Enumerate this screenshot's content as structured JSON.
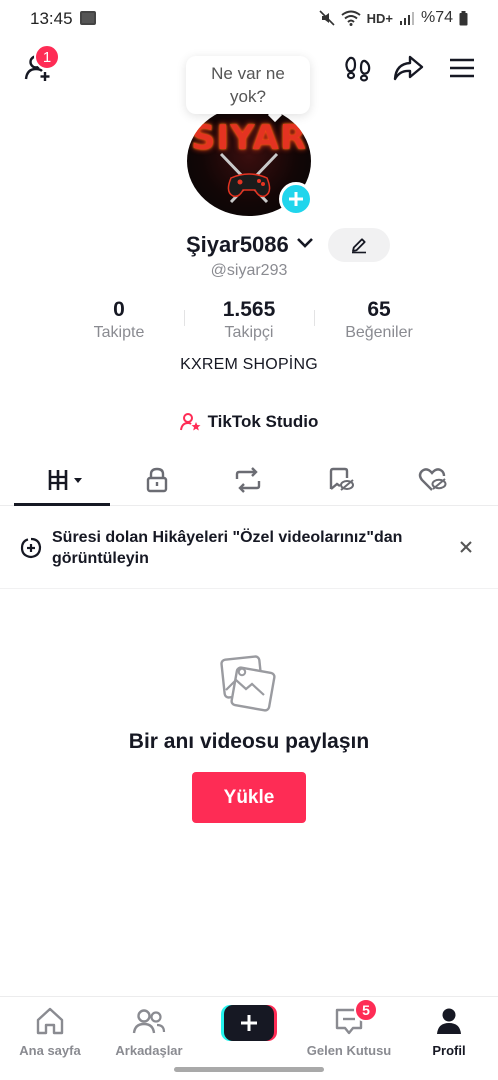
{
  "status_bar": {
    "time": "13:45",
    "battery": "%74",
    "network": "HD+"
  },
  "top_bar": {
    "friend_requests_badge": "1"
  },
  "bubble": {
    "text": "Ne var ne yok?"
  },
  "avatar": {
    "text": "SIYAR"
  },
  "profile": {
    "username": "Şiyar5086",
    "handle": "@siyar293",
    "bio": "KXREM SHOPİNG"
  },
  "stats": [
    {
      "value": "0",
      "label": "Takipte"
    },
    {
      "value": "1.565",
      "label": "Takipçi"
    },
    {
      "value": "65",
      "label": "Beğeniler"
    }
  ],
  "studio": {
    "label": "TikTok Studio"
  },
  "tabs": [
    {
      "name": "videos-grid",
      "icon": "grid-icon",
      "active": true
    },
    {
      "name": "private",
      "icon": "lock-icon",
      "active": false
    },
    {
      "name": "reposts",
      "icon": "repost-icon",
      "active": false
    },
    {
      "name": "favorites",
      "icon": "bookmark-hidden-icon",
      "active": false
    },
    {
      "name": "liked",
      "icon": "heart-hidden-icon",
      "active": false
    }
  ],
  "notice": {
    "text": "Süresi dolan Hikâyeleri \"Özel videolarınız\"dan görüntüleyin"
  },
  "empty_state": {
    "title": "Bir anı videosu paylaşın",
    "button": "Yükle"
  },
  "bottom_nav": {
    "home": "Ana sayfa",
    "friends": "Arkadaşlar",
    "inbox": "Gelen Kutusu",
    "inbox_badge": "5",
    "profile": "Profil"
  },
  "colors": {
    "accent": "#fe2c55",
    "cyan": "#25f4ee",
    "avatar_plus": "#20d5ec",
    "text": "#161823",
    "muted": "#8a8b91"
  }
}
